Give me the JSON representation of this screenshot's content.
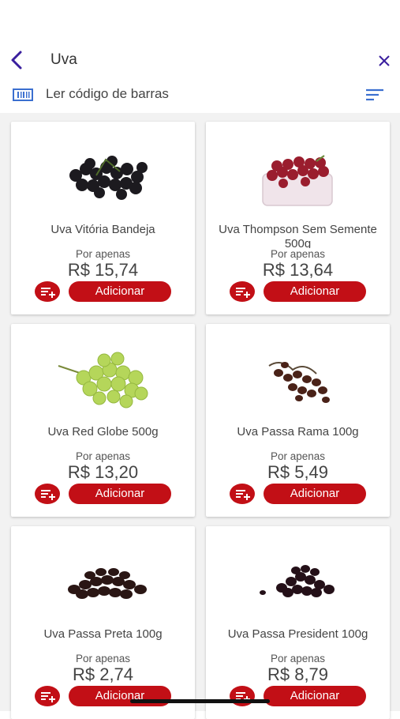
{
  "search": {
    "value": "Uva"
  },
  "barcode": {
    "label": "Ler código de barras"
  },
  "products": [
    {
      "name": "Uva Vitória Bandeja",
      "label": "Por apenas",
      "price": "R$ 15,74",
      "add_label": "Adicionar",
      "image": "black-grapes"
    },
    {
      "name": "Uva Thompson Sem Semente 500g",
      "label": "Por apenas",
      "price": "R$ 13,64",
      "add_label": "Adicionar",
      "image": "red-grapes-tray"
    },
    {
      "name": "Uva Red Globe 500g",
      "label": "Por apenas",
      "price": "R$ 13,20",
      "add_label": "Adicionar",
      "image": "green-grapes"
    },
    {
      "name": "Uva Passa Rama 100g",
      "label": "Por apenas",
      "price": "R$ 5,49",
      "add_label": "Adicionar",
      "image": "raisins-branch"
    },
    {
      "name": "Uva Passa Preta 100g",
      "label": "Por apenas",
      "price": "R$ 2,74",
      "add_label": "Adicionar",
      "image": "dark-raisins"
    },
    {
      "name": "Uva Passa President 100g",
      "label": "Por apenas",
      "price": "R$ 8,79",
      "add_label": "Adicionar",
      "image": "raisins-pile"
    }
  ],
  "colors": {
    "accent": "#c20f16",
    "nav": "#3a1f9e",
    "barcode": "#3b6fd0"
  }
}
